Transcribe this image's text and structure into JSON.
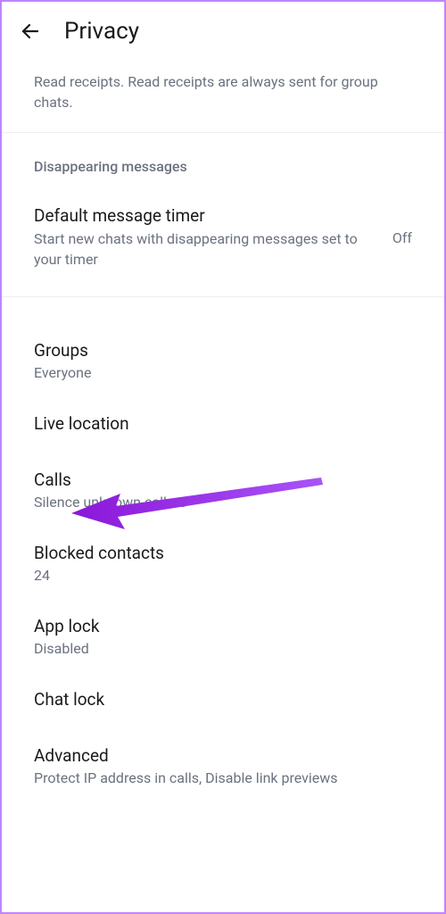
{
  "header": {
    "title": "Privacy"
  },
  "partial": {
    "text": "Read receipts. Read receipts are always sent for group chats."
  },
  "disappearing": {
    "header": "Disappearing messages",
    "timer": {
      "title": "Default message timer",
      "sub": "Start new chats with disappearing messages set to your timer",
      "value": "Off"
    }
  },
  "items": {
    "groups": {
      "title": "Groups",
      "sub": "Everyone"
    },
    "liveLocation": {
      "title": "Live location"
    },
    "calls": {
      "title": "Calls",
      "sub": "Silence unknown callers"
    },
    "blocked": {
      "title": "Blocked contacts",
      "sub": "24"
    },
    "appLock": {
      "title": "App lock",
      "sub": "Disabled"
    },
    "chatLock": {
      "title": "Chat lock"
    },
    "advanced": {
      "title": "Advanced",
      "sub": "Protect IP address in calls, Disable link previews"
    }
  }
}
